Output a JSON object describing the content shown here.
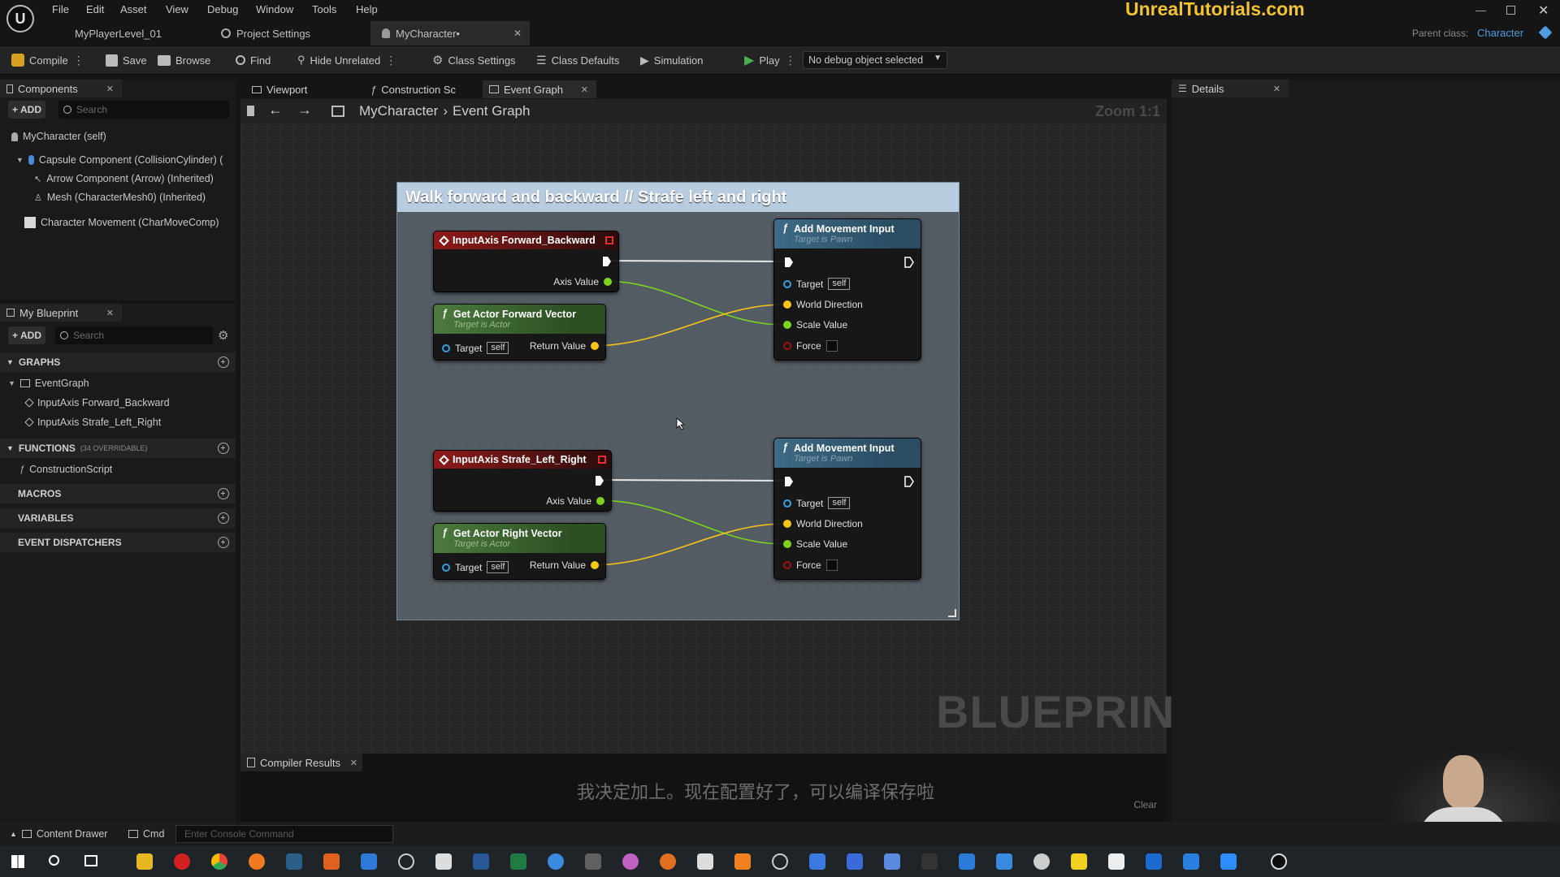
{
  "menu": [
    "File",
    "Edit",
    "Asset",
    "View",
    "Debug",
    "Window",
    "Tools",
    "Help"
  ],
  "brand": "UnrealTutorials.com",
  "parent_class": {
    "label": "Parent class:",
    "value": "Character"
  },
  "doc_tabs": [
    {
      "label": "MyPlayerLevel_01"
    },
    {
      "label": "Project Settings"
    },
    {
      "label": "MyCharacter•"
    }
  ],
  "toolbar": {
    "compile": "Compile",
    "save": "Save",
    "browse": "Browse",
    "find": "Find",
    "hide_unrelated": "Hide Unrelated",
    "class_settings": "Class Settings",
    "class_defaults": "Class Defaults",
    "simulation": "Simulation",
    "play": "Play",
    "debug_object": "No debug object selected"
  },
  "components_panel": {
    "title": "Components",
    "add": "ADD",
    "search_placeholder": "Search",
    "items": [
      "MyCharacter (self)",
      "Capsule Component (CollisionCylinder) (",
      "Arrow Component (Arrow) (Inherited)",
      "Mesh (CharacterMesh0) (Inherited)",
      "Character Movement (CharMoveComp)"
    ]
  },
  "blueprint_panel": {
    "title": "My Blueprint",
    "add": "ADD",
    "search_placeholder": "Search",
    "graphs_label": "GRAPHS",
    "event_graph": "EventGraph",
    "graph_items": [
      "InputAxis Forward_Backward",
      "InputAxis Strafe_Left_Right"
    ],
    "functions_label": "FUNCTIONS",
    "functions_count": "(34 OVERRIDABLE)",
    "construction_script": "ConstructionScript",
    "macros_label": "MACROS",
    "variables_label": "VARIABLES",
    "dispatchers_label": "EVENT DISPATCHERS"
  },
  "editor_tabs": [
    "Viewport",
    "Construction Sc",
    "Event Graph"
  ],
  "breadcrumb": {
    "root": "MyCharacter",
    "current": "Event Graph"
  },
  "zoom": "Zoom 1:1",
  "details_title": "Details",
  "graph": {
    "comment": "Walk forward and backward // Strafe left and right",
    "watermark": "BLUEPRINT",
    "event1": "InputAxis Forward_Backward",
    "event2": "InputAxis Strafe_Left_Right",
    "axis_value": "Axis Value",
    "get_forward": "Get Actor Forward Vector",
    "get_right": "Get Actor Right Vector",
    "target_is_actor": "Target is Actor",
    "target": "Target",
    "self": "self",
    "return_value": "Return Value",
    "add_movement": "Add Movement Input",
    "target_is_pawn": "Target is Pawn",
    "world_direction": "World Direction",
    "scale_value": "Scale Value",
    "force": "Force"
  },
  "bottom": {
    "compiler_results": "Compiler Results",
    "subtitle": "我决定加上。现在配置好了，可以编译保存啦",
    "clear": "Clear"
  },
  "statusbar": {
    "content_drawer": "Content Drawer",
    "cmd": "Cmd",
    "console_placeholder": "Enter Console Command"
  },
  "colors": {
    "exec": "#ffffff",
    "float_pin": "#7ed321",
    "vector_pin": "#f5c518",
    "object_pin": "#3aa0e0",
    "bool_pin": "#a01010",
    "brand": "#f2c230",
    "accent": "#4d9de0"
  }
}
